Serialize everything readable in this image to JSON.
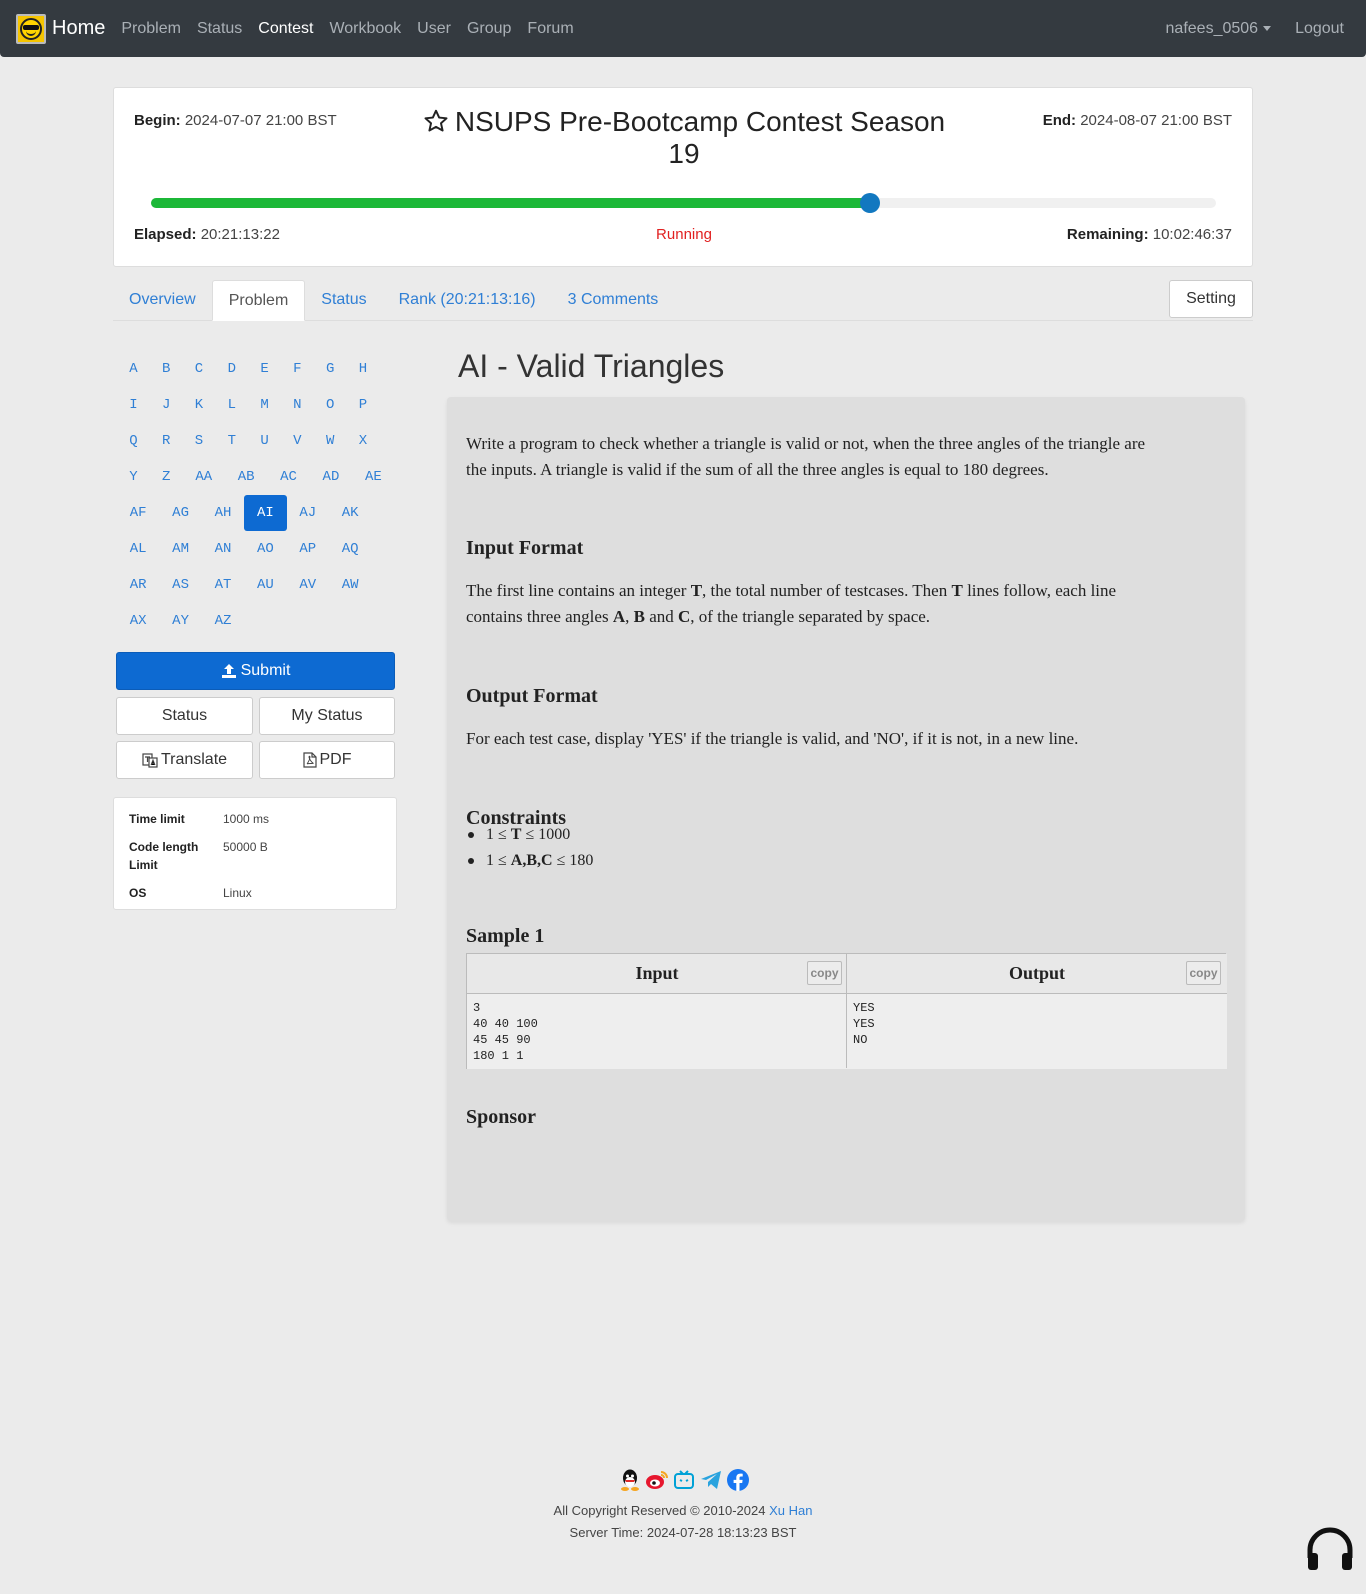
{
  "nav": {
    "brand": "Home",
    "links": [
      "Problem",
      "Status",
      "Contest",
      "Workbook",
      "User",
      "Group",
      "Forum"
    ],
    "active": "Contest",
    "user": "nafees_0506",
    "logout": "Logout"
  },
  "contest": {
    "begin_label": "Begin:",
    "begin_value": "2024-07-07 21:00 BST",
    "end_label": "End:",
    "end_value": "2024-08-07 21:00 BST",
    "title_line1": "NSUPS Pre-Bootcamp Contest Season",
    "title_line2": "19",
    "progress_fraction": 0.675,
    "elapsed_label": "Elapsed:",
    "elapsed_value": "20:21:13:22",
    "status": "Running",
    "remaining_label": "Remaining:",
    "remaining_value": "10:02:46:37",
    "status_color": "#e12121",
    "progress_color": "#1cb838"
  },
  "tabs": [
    {
      "label": "Overview"
    },
    {
      "label": "Problem",
      "active": true
    },
    {
      "label": "Status"
    },
    {
      "label": "Rank (20:21:13:16)"
    },
    {
      "label": "3 Comments"
    }
  ],
  "setting_label": "Setting",
  "problem_rows": [
    [
      "A",
      "B",
      "C",
      "D",
      "E",
      "F",
      "G",
      "H"
    ],
    [
      "I",
      "J",
      "K",
      "L",
      "M",
      "N",
      "O",
      "P"
    ],
    [
      "Q",
      "R",
      "S",
      "T",
      "U",
      "V",
      "W",
      "X"
    ],
    [
      "Y",
      "Z",
      "AA",
      "AB",
      "AC",
      "AD",
      "AE"
    ],
    [
      "AF",
      "AG",
      "AH",
      "AI",
      "AJ",
      "AK"
    ],
    [
      "AL",
      "AM",
      "AN",
      "AO",
      "AP",
      "AQ"
    ],
    [
      "AR",
      "AS",
      "AT",
      "AU",
      "AV",
      "AW"
    ],
    [
      "AX",
      "AY",
      "AZ"
    ]
  ],
  "active_problem": "AI",
  "buttons": {
    "submit": "Submit",
    "status": "Status",
    "my_status": "My Status",
    "translate": "Translate",
    "pdf": "PDF"
  },
  "info": {
    "time_limit_label": "Time limit",
    "time_limit_value": "1000 ms",
    "code_length_label_1": "Code length",
    "code_length_label_2": "Limit",
    "code_length_value": "50000 B",
    "os_label": "OS",
    "os_value": "Linux"
  },
  "problem": {
    "title": "AI - Valid Triangles",
    "desc_line1": "Write a program to check whether a triangle is valid or not, when the three angles of the triangle are",
    "desc_line2": "the inputs. A triangle is valid if the sum of all the three angles is equal to 180 degrees.",
    "input_heading": "Input Format",
    "input_pre": "The first line contains an integer ",
    "input_T1": "T",
    "input_mid": ", the total number of testcases. Then ",
    "input_T2": "T",
    "input_post": " lines follow, each line",
    "input_l2_pre": "contains three angles ",
    "input_A": "A",
    "input_comma": ", ",
    "input_B": "B",
    "input_and": " and ",
    "input_C": "C",
    "input_l2_post": ", of the triangle separated by space.",
    "output_heading": "Output Format",
    "output_text": "For each test case, display 'YES' if the triangle is valid, and 'NO', if it is not, in a new line.",
    "constraints_heading": "Constraints",
    "c1_pre": "1 ≤ ",
    "c1_var": "T",
    "c1_post": " ≤ 1000",
    "c2_pre": "1 ≤ ",
    "c2_var": "A,B,C",
    "c2_post": " ≤ 180",
    "sample_heading": "Sample 1",
    "sample_input_label": "Input",
    "sample_output_label": "Output",
    "copy_label": "copy",
    "sample_input": "3\n40 40 100\n45 45 90\n180 1 1",
    "sample_output": "YES\nYES\nNO",
    "sponsor_heading": "Sponsor"
  },
  "footer": {
    "icons": [
      "qq-icon",
      "weibo-icon",
      "bilibili-icon",
      "telegram-icon",
      "facebook-icon"
    ],
    "copyright_pre": "All Copyright Reserved © 2010-2024 ",
    "copyright_link": "Xu Han",
    "server_time": "Server Time: 2024-07-28 18:13:23 BST"
  }
}
